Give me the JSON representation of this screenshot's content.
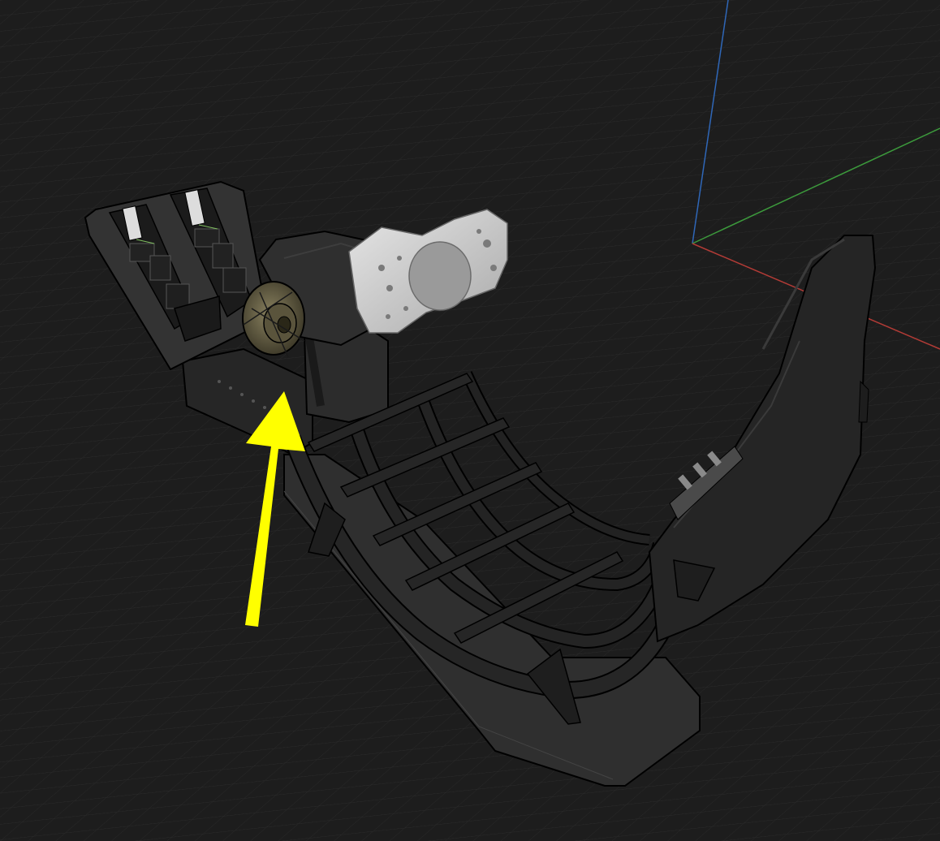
{
  "viewport": {
    "background_color": "#1d1d1d",
    "grid": true,
    "grid_color": "#2b2b2b"
  },
  "axes": {
    "x_color": "#b23b36",
    "y_color": "#3c9a3c",
    "z_color": "#2f67b8"
  },
  "model": {
    "parts": [
      "pedal-plate",
      "pedal-left",
      "pedal-right",
      "wheel-base-motor",
      "steering-wheel",
      "cockpit-frame",
      "seat",
      "base-plate"
    ],
    "frame_color": "#111111",
    "edge_color": "#000000",
    "panel_color": "#2e2e2e",
    "wheel_color": "#c8c8c8",
    "motor_color": "#4a4532"
  },
  "annotation": {
    "icon": "arrow-icon",
    "color": "#ffff00",
    "points_to": "wheel-base-motor"
  }
}
